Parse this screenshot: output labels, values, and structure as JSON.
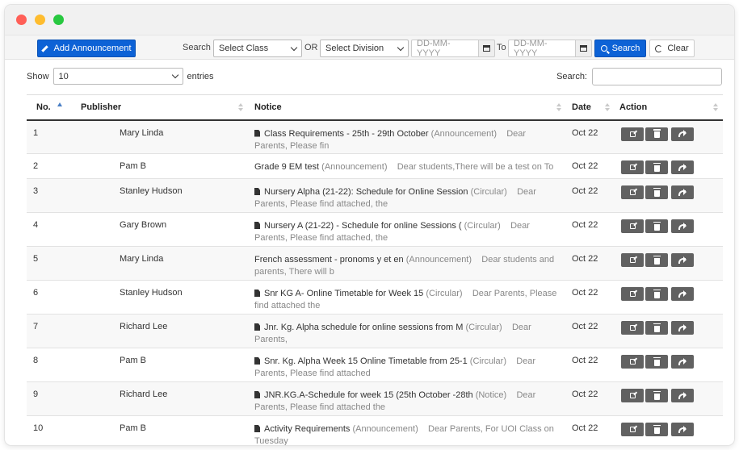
{
  "toolbar": {
    "add_label": "Add Announcement",
    "search_label": "Search",
    "class_select": "Select Class",
    "or_label": "OR",
    "division_select": "Select Division",
    "date_from_placeholder": "DD-MM-YYYY",
    "to_label": "To",
    "date_to_placeholder": "DD-MM-YYYY",
    "search_button": "Search",
    "clear_button": "Clear"
  },
  "list_controls": {
    "show_label": "Show",
    "entries_value": "10",
    "entries_label": "entries",
    "search_label": "Search:"
  },
  "table": {
    "headers": [
      "No.",
      "Publisher",
      "Notice",
      "Date",
      "Action"
    ],
    "rows": [
      {
        "no": "1",
        "publisher": "Mary Linda",
        "title": "Class Requirements - 25th - 29th October",
        "type": "(Announcement)",
        "preview": "Dear Parents, Please fin",
        "date": "Oct 22",
        "icon": true
      },
      {
        "no": "2",
        "publisher": "Pam B",
        "title": "Grade 9 EM test",
        "type": "(Announcement)",
        "preview": "Dear students,There will be a test on To",
        "date": "Oct 22",
        "icon": false
      },
      {
        "no": "3",
        "publisher": "Stanley Hudson",
        "title": "Nursery Alpha (21-22): Schedule for Online Session",
        "type": "(Circular)",
        "preview": "Dear Parents, Please find attached, the",
        "date": "Oct 22",
        "icon": true
      },
      {
        "no": "4",
        "publisher": "Gary Brown",
        "title": "Nursery A (21-22) - Schedule for online Sessions (",
        "type": "(Circular)",
        "preview": "Dear Parents, Please find attached, the",
        "date": "Oct 22",
        "icon": true
      },
      {
        "no": "5",
        "publisher": "Mary Linda",
        "title": "French assessment - pronoms y et en",
        "type": "(Announcement)",
        "preview": "Dear students and parents, There will b",
        "date": "Oct 22",
        "icon": false
      },
      {
        "no": "6",
        "publisher": "Stanley Hudson",
        "title": "Snr KG A- Online Timetable for Week 15",
        "type": "(Circular)",
        "preview": "Dear Parents, Please find attached the",
        "date": "Oct 22",
        "icon": true
      },
      {
        "no": "7",
        "publisher": "Richard Lee",
        "title": "Jnr. Kg. Alpha schedule for online sessions from M",
        "type": "(Circular)",
        "preview": "Dear Parents,",
        "date": "Oct 22",
        "icon": true
      },
      {
        "no": "8",
        "publisher": "Pam B",
        "title": "Snr. Kg. Alpha Week 15 Online Timetable from 25-1",
        "type": "(Circular)",
        "preview": "Dear Parents, Please find attached",
        "date": "Oct 22",
        "icon": true
      },
      {
        "no": "9",
        "publisher": "Richard Lee",
        "title": "JNR.KG.A-Schedule for week 15 (25th October -28th",
        "type": "(Notice)",
        "preview": "Dear Parents, Please find attached the",
        "date": "Oct 22",
        "icon": true
      },
      {
        "no": "10",
        "publisher": "Pam B",
        "title": "Activity Requirements",
        "type": "(Announcement)",
        "preview": "Dear Parents, For UOI Class on Tuesday",
        "date": "Oct 22",
        "icon": true
      }
    ]
  },
  "colors": {
    "primary": "#0d62d6",
    "action_button": "#616161"
  }
}
